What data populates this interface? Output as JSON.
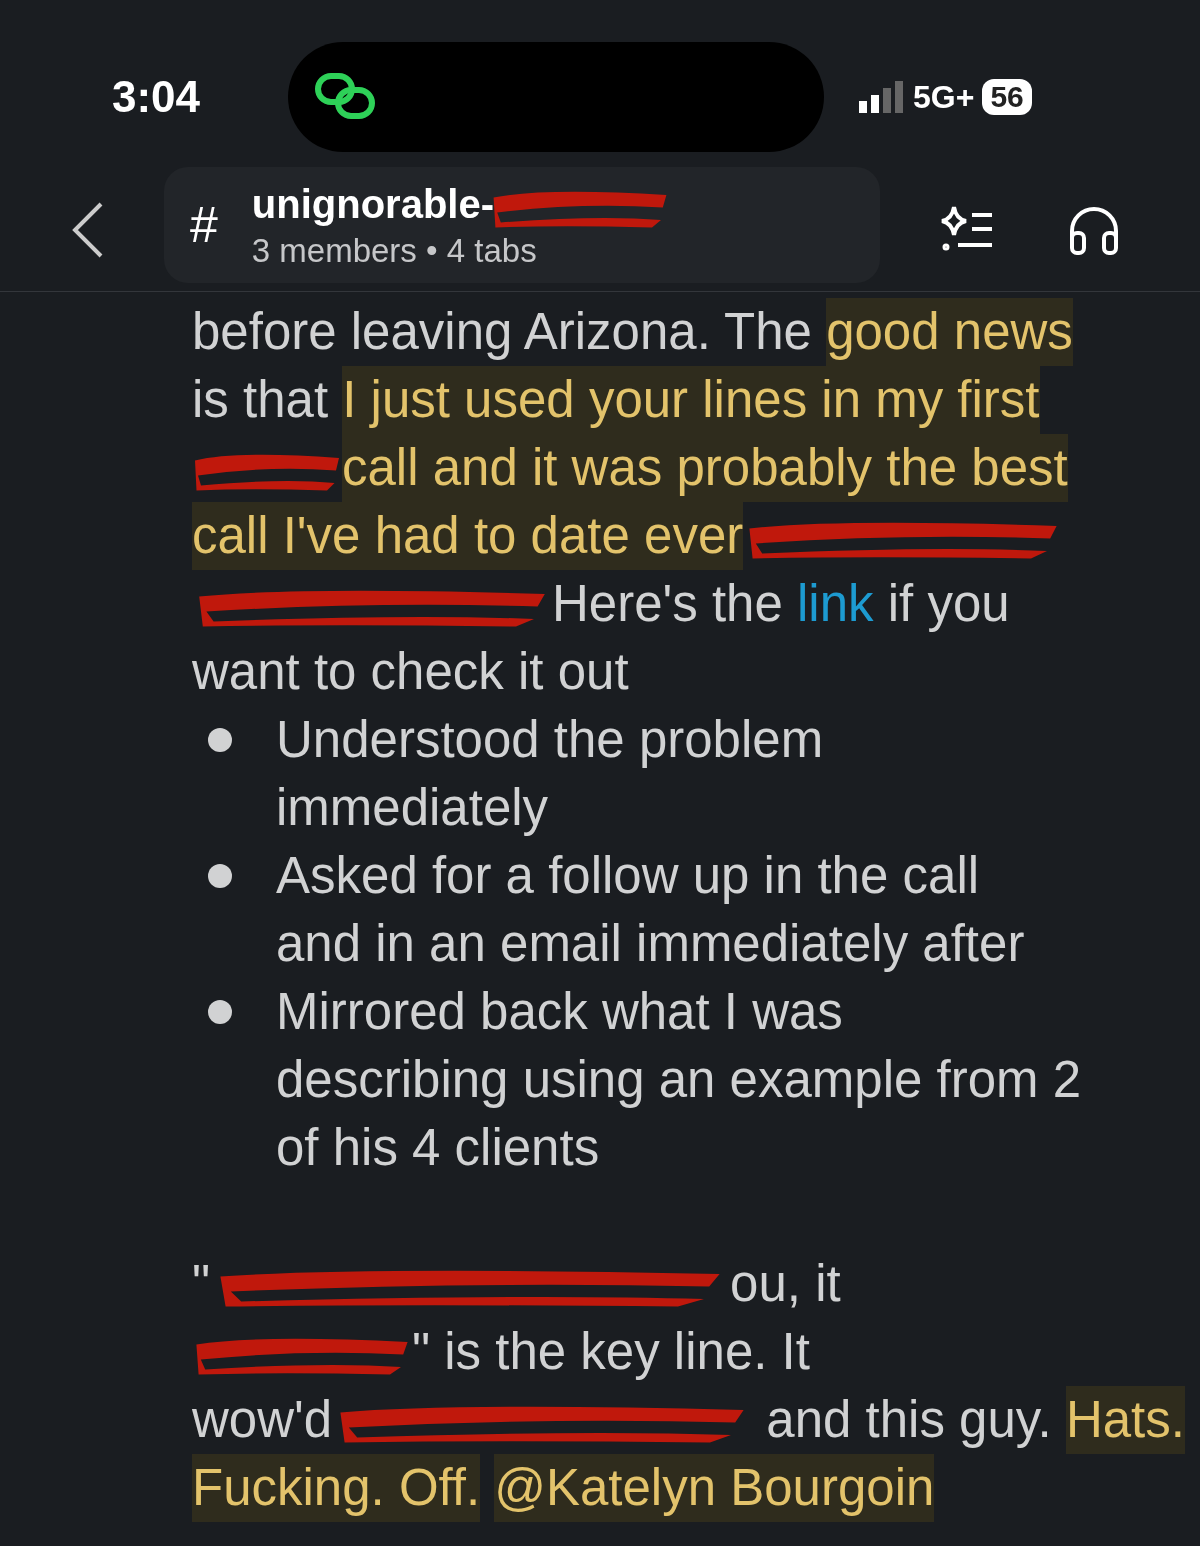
{
  "status_bar": {
    "time": "3:04",
    "network": "5G+",
    "battery": "56"
  },
  "header": {
    "title": "unignorable-",
    "title_redacted": true,
    "subtitle": "3 members • 4 tabs",
    "hash": "#"
  },
  "message": {
    "lines": [
      {
        "segments": [
          {
            "kind": "text",
            "text": "before leaving Arizona. The ",
            "highlighted": false
          },
          {
            "kind": "text",
            "text": "good news",
            "highlighted": true
          }
        ]
      },
      {
        "segments": [
          {
            "kind": "text",
            "text": "is that ",
            "highlighted": false
          },
          {
            "kind": "text",
            "text": "I just used your lines in my first",
            "highlighted": true
          }
        ]
      },
      {
        "segments": [
          {
            "kind": "redaction"
          },
          {
            "kind": "text",
            "text": "call and it was probably the best",
            "highlighted": true
          }
        ]
      },
      {
        "segments": [
          {
            "kind": "text",
            "text": "call I've had to date ever",
            "highlighted": true
          },
          {
            "kind": "redaction"
          }
        ]
      },
      {
        "segments": [
          {
            "kind": "redaction"
          },
          {
            "kind": "text",
            "text": "Here's the ",
            "highlighted": false
          },
          {
            "kind": "link",
            "text": "link"
          },
          {
            "kind": "text",
            "text": " if you",
            "highlighted": false
          }
        ]
      },
      {
        "segments": [
          {
            "kind": "text",
            "text": "want to check it out",
            "highlighted": false
          }
        ]
      }
    ],
    "bullets": [
      {
        "lines": [
          "Understood the problem",
          "immediately"
        ]
      },
      {
        "lines": [
          "Asked for a follow up in the call",
          "and in an email immediately after"
        ]
      },
      {
        "lines": [
          "Mirrored back what I was",
          "describing using an example from 2",
          "of his 4 clients"
        ]
      }
    ],
    "lines_after": [
      {
        "segments": [
          {
            "kind": "text",
            "text": "\"",
            "highlighted": false
          },
          {
            "kind": "redaction"
          },
          {
            "kind": "text",
            "text": "ou, it",
            "highlighted": false
          }
        ]
      },
      {
        "segments": [
          {
            "kind": "redaction"
          },
          {
            "kind": "text",
            "text": "\" is the key line. It",
            "highlighted": false
          }
        ]
      },
      {
        "segments": [
          {
            "kind": "text",
            "text": "wow'd",
            "highlighted": false
          },
          {
            "kind": "redaction"
          },
          {
            "kind": "text",
            "text": " and this guy. ",
            "highlighted": false
          },
          {
            "kind": "text",
            "text": "Hats.",
            "highlighted": true
          }
        ]
      },
      {
        "segments": [
          {
            "kind": "text",
            "text": "Fucking. Off.",
            "highlighted": true
          },
          {
            "kind": "mention",
            "text": "@Katelyn Bourgoin",
            "highlighted": true
          }
        ]
      }
    ]
  }
}
